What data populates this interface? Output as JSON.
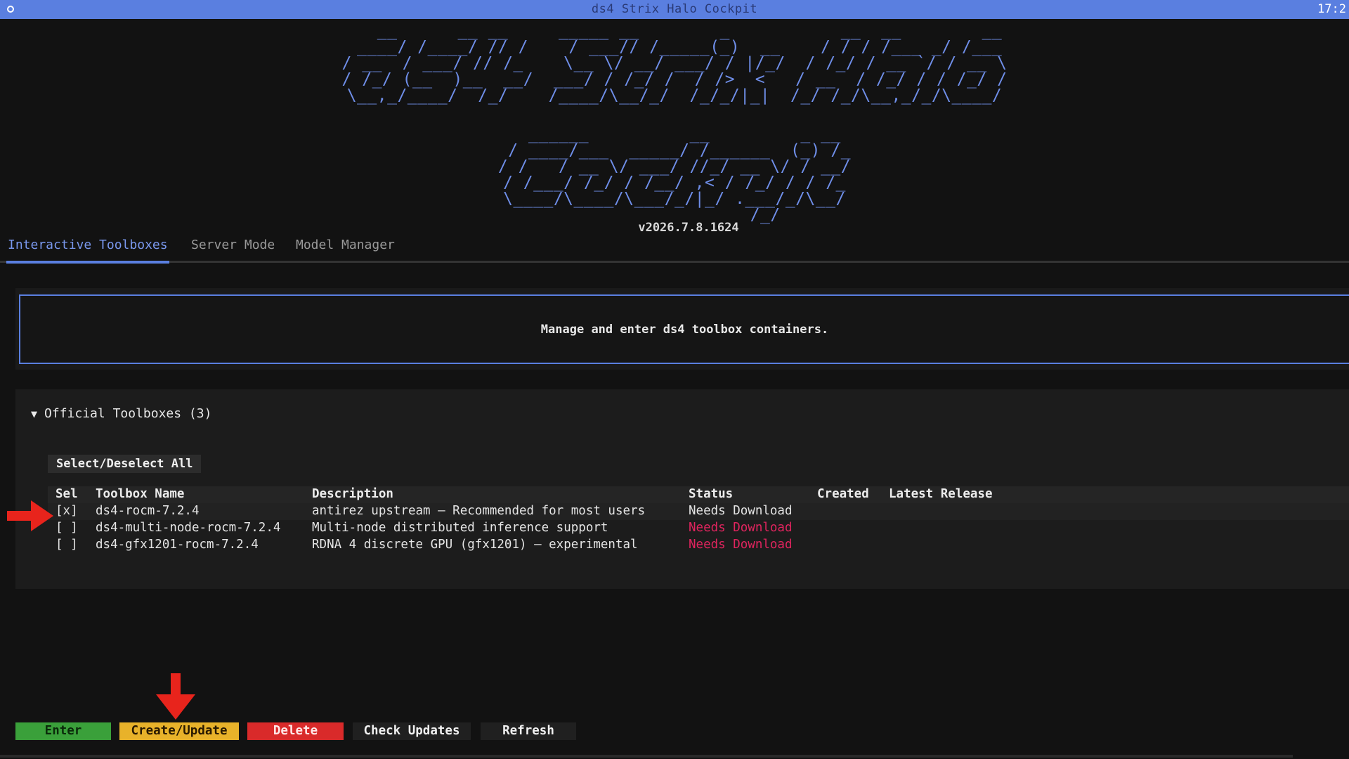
{
  "window": {
    "title": "ds4 Strix Halo Cockpit",
    "clock": "17:2"
  },
  "banner": {
    "line1": "   __      __ __     _____ __        _           __  __        __\n ____/ /____/ // /    / ___// /_____(_)  __    / / / /___ _/ /___\n/ __  / ___/ // /_    \\__ \\/ __/ ___/ / |/_/  / /_/ / __ `/ / __ \\\n/ /_/ (__  )__  __/  ___/ / /_/ /  / />  <   / __  / /_/ / / /_/ /\n\\__,_/____/  /_/    /____/\\__/_/  /_/_/|_|  /_/ /_/\\__,_/_/\\____/",
    "line2": "  ______          __         _ __\n / ____/___  _____/ /______  (_) /_\n/ /   / __ \\/ ___/ //_/ __ \\/ / __/\n/ /___/ /_/ / /__/ ,< / /_/ / / /_\n\\____/\\____/\\___/_/|_/ .___/_/\\__/\n                  /_/",
    "version": "v2026.7.8.1624"
  },
  "tabs": [
    {
      "label": "Interactive Toolboxes",
      "active": true
    },
    {
      "label": "Server Mode",
      "active": false
    },
    {
      "label": "Model Manager",
      "active": false
    }
  ],
  "info": {
    "text": "Manage and enter ds4 toolbox containers."
  },
  "section": {
    "caret": "▼",
    "title": "Official Toolboxes (3)",
    "select_all_label": "Select/Deselect All"
  },
  "table": {
    "headers": {
      "sel": "Sel",
      "name": "Toolbox Name",
      "description": "Description",
      "status": "Status",
      "created": "Created",
      "latest": "Latest Release"
    },
    "rows": [
      {
        "sel": "[x]",
        "name": "ds4-rocm-7.2.4",
        "description": "antirez upstream — Recommended for most users",
        "status": "Needs Download",
        "created": "",
        "latest": ""
      },
      {
        "sel": "[ ]",
        "name": "ds4-multi-node-rocm-7.2.4",
        "description": "Multi-node distributed inference support",
        "status": "Needs Download",
        "created": "",
        "latest": ""
      },
      {
        "sel": "[ ]",
        "name": "ds4-gfx1201-rocm-7.2.4",
        "description": "RDNA 4 discrete GPU (gfx1201) — experimental",
        "status": "Needs Download",
        "created": "",
        "latest": ""
      }
    ]
  },
  "buttons": {
    "enter": "Enter",
    "create": "Create/Update",
    "delete": "Delete",
    "check": "Check Updates",
    "refresh": "Refresh"
  },
  "colors": {
    "accent": "#5a7fe0",
    "enter_green": "#3aa03a",
    "create_yellow": "#e8b22a",
    "delete_red": "#d92a2a",
    "warn_status": "#e0245e",
    "annotation_arrow": "#e8241c"
  },
  "annotations": {
    "arrow_1": "arrow-right-icon",
    "arrow_2": "arrow-down-icon"
  }
}
